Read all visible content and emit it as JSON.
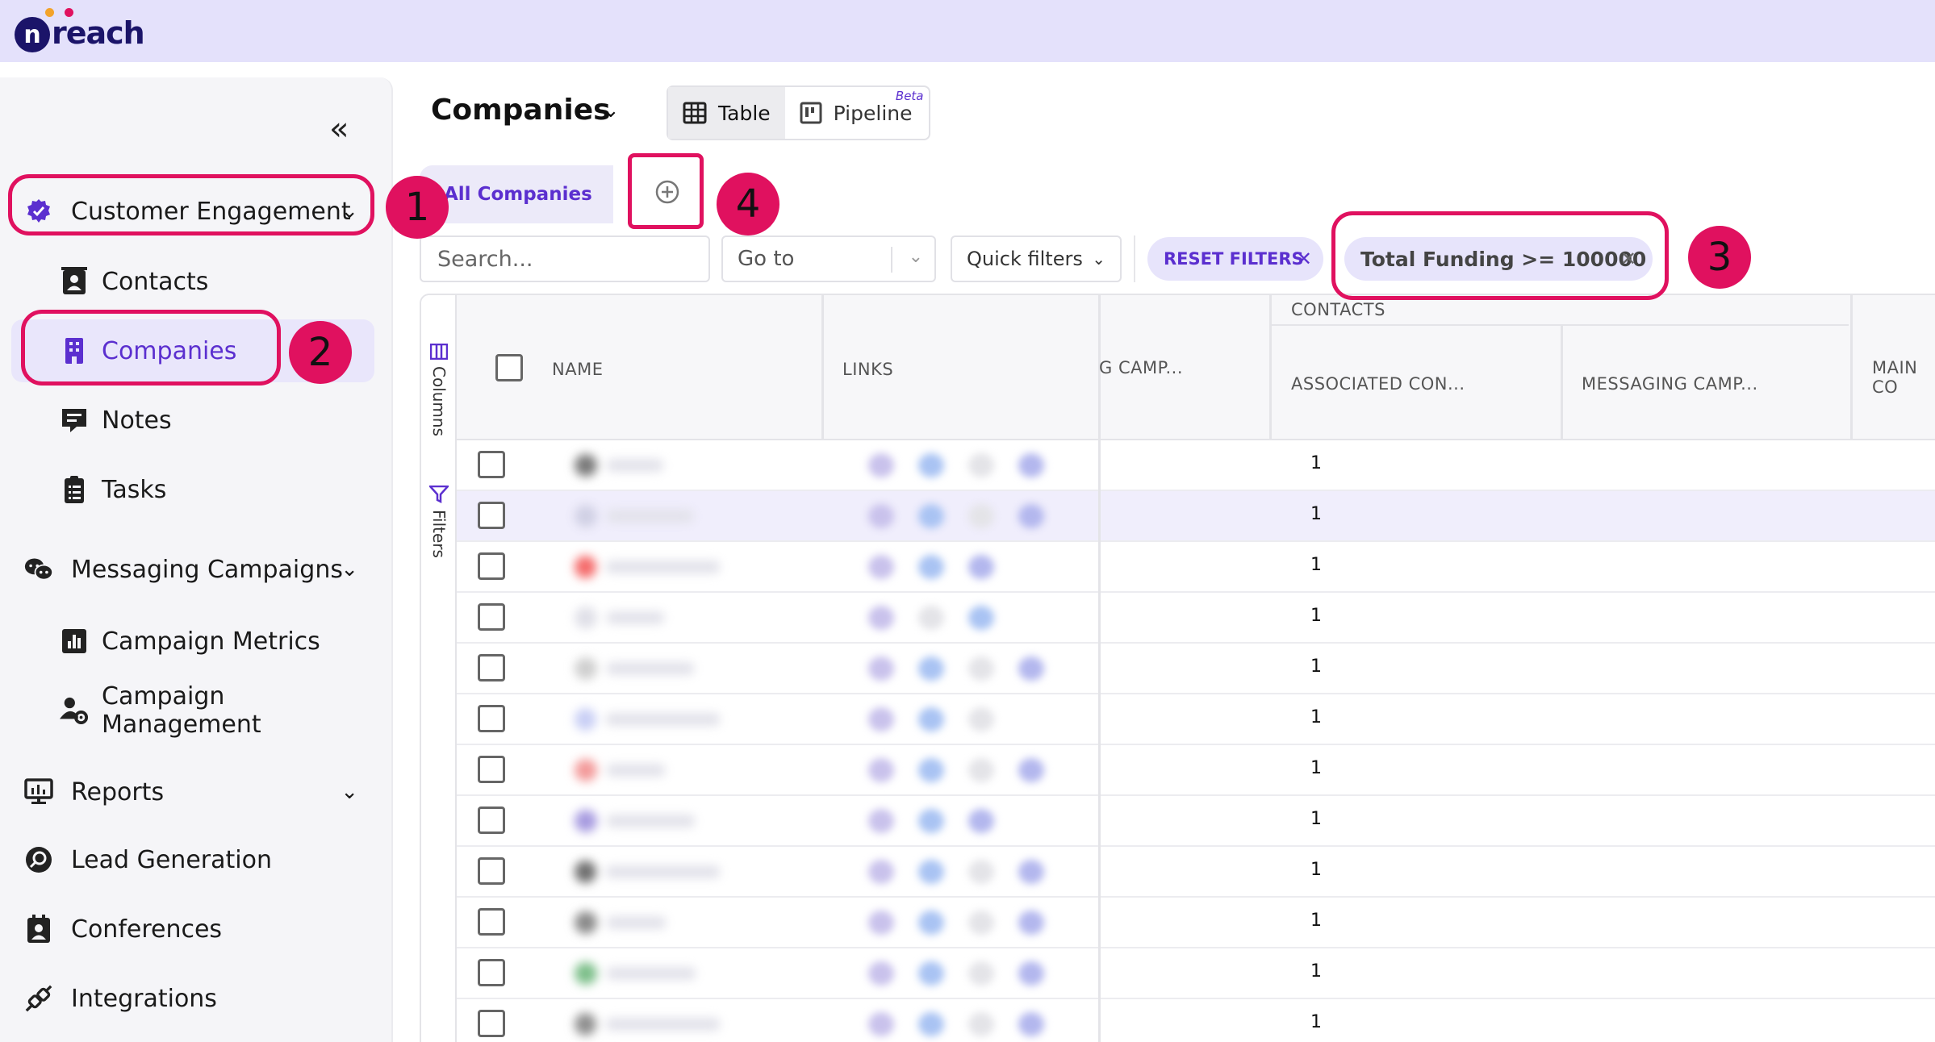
{
  "app": {
    "logo_n": "n",
    "logo_text": "reach"
  },
  "sidebar": {
    "collapse_label": "«",
    "groups": [
      {
        "label": "Customer Engagement"
      },
      {
        "label": "Messaging Campaigns"
      },
      {
        "label": "Reports"
      },
      {
        "label": "Lead Generation"
      },
      {
        "label": "Conferences"
      },
      {
        "label": "Integrations"
      }
    ],
    "items": [
      {
        "label": "Contacts"
      },
      {
        "label": "Companies"
      },
      {
        "label": "Notes"
      },
      {
        "label": "Tasks"
      },
      {
        "label": "Campaign Metrics"
      },
      {
        "label": "Campaign Management"
      }
    ]
  },
  "header": {
    "title": "Companies",
    "view_table": "Table",
    "view_pipeline": "Pipeline",
    "beta": "Beta"
  },
  "views": {
    "all_label": "All Companies",
    "add_label": "⊕"
  },
  "filters": {
    "search_placeholder": "Search...",
    "goto_label": "Go to",
    "quick_label": "Quick filters",
    "reset_label": "RESET FILTERS",
    "active_chip": "Total Funding >= 100000"
  },
  "annotations": [
    "1",
    "2",
    "3",
    "4"
  ],
  "table": {
    "group_header": "CONTACTS",
    "columns": [
      "NAME",
      "LINKS",
      "G CAMP...",
      "ASSOCIATED CON...",
      "MESSAGING CAMP...",
      "MAIN CO"
    ],
    "tools": [
      "Columns",
      "Filters"
    ],
    "rows": [
      {
        "associated": "1"
      },
      {
        "associated": "1"
      },
      {
        "associated": "1"
      },
      {
        "associated": "1"
      },
      {
        "associated": "1"
      },
      {
        "associated": "1"
      },
      {
        "associated": "1"
      },
      {
        "associated": "1"
      },
      {
        "associated": "1"
      },
      {
        "associated": "1"
      },
      {
        "associated": "1"
      },
      {
        "associated": "1"
      }
    ]
  },
  "colors": {
    "accent": "#5b2fcf",
    "annotation": "#e0115f",
    "topbar": "#e4e1fb"
  }
}
